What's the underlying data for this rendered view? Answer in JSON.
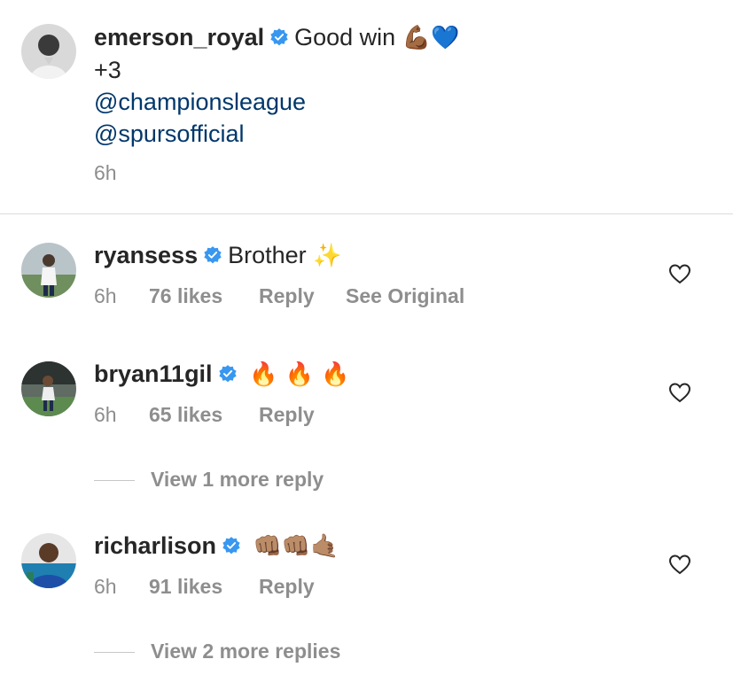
{
  "caption": {
    "username": "emerson_royal",
    "text": "Good win",
    "emoji": "💪🏾💙",
    "line2": "+3",
    "mention1": "@championsleague",
    "mention2": "@spursofficial",
    "time": "6h"
  },
  "comments": [
    {
      "username": "ryansess",
      "text": "Brother",
      "emoji": "✨",
      "time": "6h",
      "likes": "76 likes",
      "reply": "Reply",
      "extra": "See Original"
    },
    {
      "username": "bryan11gil",
      "text": "",
      "emoji": "🔥 🔥 🔥",
      "time": "6h",
      "likes": "65 likes",
      "reply": "Reply",
      "view_more": "View 1 more reply"
    },
    {
      "username": "richarlison",
      "text": "",
      "emoji": "👊🏽👊🏽🤙🏽",
      "time": "6h",
      "likes": "91 likes",
      "reply": "Reply",
      "view_more": "View 2 more replies"
    }
  ],
  "colors": {
    "mention": "#00376b",
    "verified": "#3897f0",
    "muted": "#8e8e8e"
  },
  "icons": {
    "verified": "verified-badge-icon",
    "like": "heart-outline-icon"
  }
}
